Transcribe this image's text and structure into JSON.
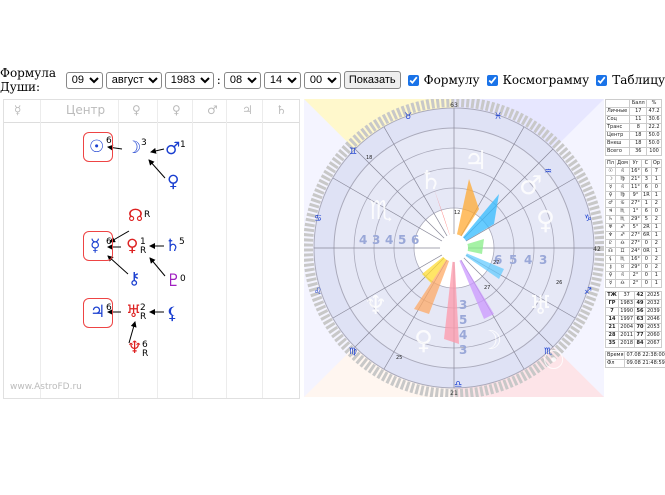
{
  "toolbar": {
    "label": "Формула Души:",
    "day": "09",
    "month": "августа",
    "year": "1983",
    "hour": "08",
    "minute": "14",
    "second": "00",
    "sep1": ":",
    "sep2": ":",
    "show_button": "Показать",
    "cb_formula": "Формулу",
    "cb_cosmogram": "Космограмму",
    "cb_table": "Таблицу"
  },
  "formula": {
    "header": [
      "☿",
      "Центр",
      "♀",
      "♀",
      "♂",
      "♃",
      "♄"
    ],
    "nodes": [
      {
        "glyph": "☉",
        "num": "6",
        "color": "#1a3fd0"
      },
      {
        "glyph": "☽",
        "num": "3",
        "color": "#1a3fd0"
      },
      {
        "glyph": "♂",
        "num": "1",
        "color": "#1a3fd0"
      },
      {
        "glyph": "♀",
        "num": "",
        "color": "#1a3fd0"
      },
      {
        "glyph": "☊",
        "num": "R",
        "color": "#d22"
      },
      {
        "glyph": "☿",
        "num": "6",
        "color": "#1a3fd0"
      },
      {
        "glyph": "♀",
        "num": "1",
        "sub": "R",
        "color": "#d22"
      },
      {
        "glyph": "♄",
        "num": "5",
        "color": "#1a3fd0"
      },
      {
        "glyph": "⚷",
        "num": "",
        "color": "#1a3fd0"
      },
      {
        "glyph": "♇",
        "num": "0",
        "color": "#a020c0"
      },
      {
        "glyph": "♃",
        "num": "6",
        "color": "#1a3fd0"
      },
      {
        "glyph": "♅",
        "num": "2",
        "sub": "R",
        "color": "#d22"
      },
      {
        "glyph": "⚸",
        "num": "",
        "color": "#1a3fd0"
      },
      {
        "glyph": "♆",
        "num": "6",
        "sub": "R",
        "color": "#d22"
      }
    ],
    "watermark": "www.AstroFD.ru"
  },
  "cosmogram": {
    "outer_labels": [
      "63",
      "21",
      "42"
    ],
    "ring_numbers": [
      "4",
      "3",
      "4",
      "5",
      "6",
      "3",
      "5",
      "4",
      "3",
      "6",
      "5",
      "4",
      "3"
    ],
    "small_labels": [
      "27",
      "27",
      "12",
      "25",
      "26",
      "18"
    ]
  },
  "table": {
    "summary_head": [
      "",
      "Балл",
      "%"
    ],
    "summary": [
      [
        "Личные",
        "17",
        "47.2"
      ],
      [
        "Соц",
        "11",
        "30.6"
      ],
      [
        "Транс",
        "8",
        "22.2"
      ],
      [
        "Центр",
        "18",
        "50.0"
      ],
      [
        "Внеш",
        "18",
        "50.0"
      ],
      [
        "Всего",
        "36",
        "100"
      ]
    ],
    "planets_head": [
      "Пл",
      "Дом",
      "Уг",
      "С",
      "Ор"
    ],
    "planets": [
      [
        "☉",
        "♌",
        "16°",
        "6",
        "7"
      ],
      [
        "☽",
        "♍",
        "21°",
        "3",
        "1"
      ],
      [
        "☿",
        "♌",
        "11°",
        "6",
        "0"
      ],
      [
        "♀",
        "♍",
        "9°",
        "1R",
        "1"
      ],
      [
        "♂",
        "♋",
        "27°",
        "1",
        "2"
      ],
      [
        "♃",
        "♏",
        "1°",
        "6",
        "0"
      ],
      [
        "♄",
        "♏",
        "29°",
        "5",
        "2"
      ],
      [
        "♅",
        "♐",
        "5°",
        "2R",
        "1"
      ],
      [
        "♆",
        "♐",
        "27°",
        "6R",
        "1"
      ],
      [
        "♇",
        "♎",
        "27°",
        "0",
        "2"
      ],
      [
        "☊",
        "♊",
        "24°",
        "0R",
        "1"
      ],
      [
        "⚸",
        "♏",
        "16°",
        "0",
        "2"
      ],
      [
        "⚷",
        "♉",
        "29°",
        "0",
        "2"
      ],
      [
        "♀",
        "♌",
        "2°",
        "0",
        "1"
      ],
      [
        "☿",
        "♎",
        "2°",
        "0",
        "1"
      ]
    ],
    "years": [
      [
        "ТЖ",
        "37",
        "42",
        "2025"
      ],
      [
        "ГР",
        "1983",
        "49",
        "2032"
      ],
      [
        "7",
        "1990",
        "56",
        "2039"
      ],
      [
        "14",
        "1997",
        "63",
        "2046"
      ],
      [
        "21",
        "2004",
        "70",
        "2053"
      ],
      [
        "28",
        "2011",
        "77",
        "2060"
      ],
      [
        "35",
        "2018",
        "84",
        "2067"
      ]
    ],
    "time_rows": [
      [
        "Время",
        "07.08 22:38:00"
      ],
      [
        "Фл",
        "09.08 21:48:59"
      ]
    ]
  },
  "colors": {
    "blue": "#1a3fd0",
    "red": "#d22",
    "purple": "#a020c0",
    "box": "#e44"
  }
}
